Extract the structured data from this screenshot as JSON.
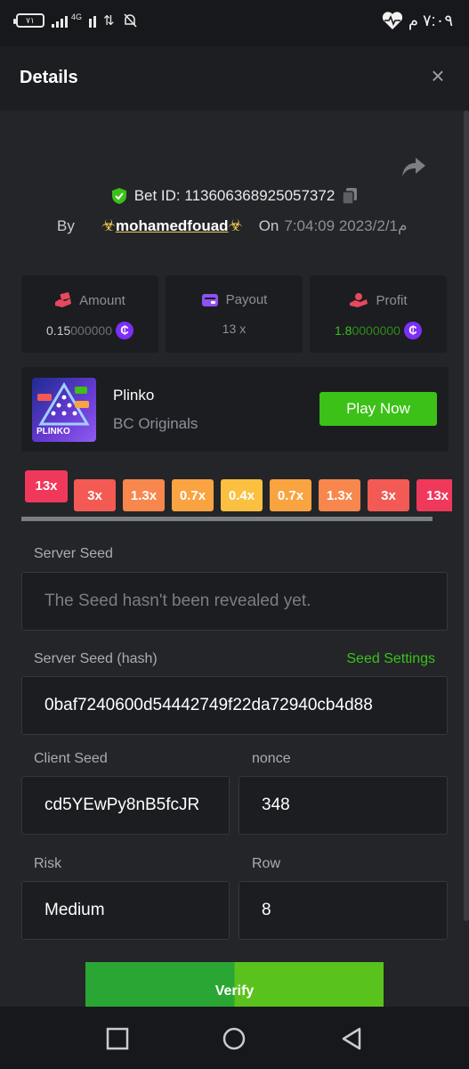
{
  "status_bar": {
    "battery": "٧١",
    "network": "4G",
    "time": "٧:٠٩ م"
  },
  "header": {
    "title": "Details",
    "close": "×"
  },
  "bet": {
    "id_label": "Bet ID: 113606368925057372",
    "by": "By",
    "user": "mohamedfouad",
    "on": "On",
    "date": "7:04:09 2023/2/1م"
  },
  "stats": {
    "amount": {
      "label": "Amount",
      "value_main": "0.15",
      "value_rest": "000000"
    },
    "payout": {
      "label": "Payout",
      "value": "13 x"
    },
    "profit": {
      "label": "Profit",
      "value_main": "1.8",
      "value_rest": "0000000",
      "color": "#3bc117"
    },
    "coin_symbol": "₵"
  },
  "game": {
    "name": "Plinko",
    "provider": "BC Originals",
    "thumb_label": "PLINKO",
    "play_label": "Play Now"
  },
  "multipliers": [
    "13x",
    "3x",
    "1.3x",
    "0.7x",
    "0.4x",
    "0.7x",
    "1.3x",
    "3x",
    "13x"
  ],
  "multiplier_colors": [
    "#f0385b",
    "#f25a53",
    "#f7874c",
    "#f9a341",
    "#fbc03f",
    "#f9a341",
    "#f7874c",
    "#f25a53",
    "#f0385b"
  ],
  "fields": {
    "server_seed_label": "Server Seed",
    "server_seed_value": "The Seed hasn't been revealed yet.",
    "server_hash_label": "Server Seed (hash)",
    "seed_settings": "Seed Settings",
    "server_hash_value": "0baf7240600d54442749f22da72940cb4d88",
    "client_seed_label": "Client Seed",
    "client_seed_value": "cd5YEwPy8nB5fcJR",
    "nonce_label": "nonce",
    "nonce_value": "348",
    "risk_label": "Risk",
    "risk_value": "Medium",
    "row_label": "Row",
    "row_value": "8"
  },
  "verify_label": "Verify"
}
